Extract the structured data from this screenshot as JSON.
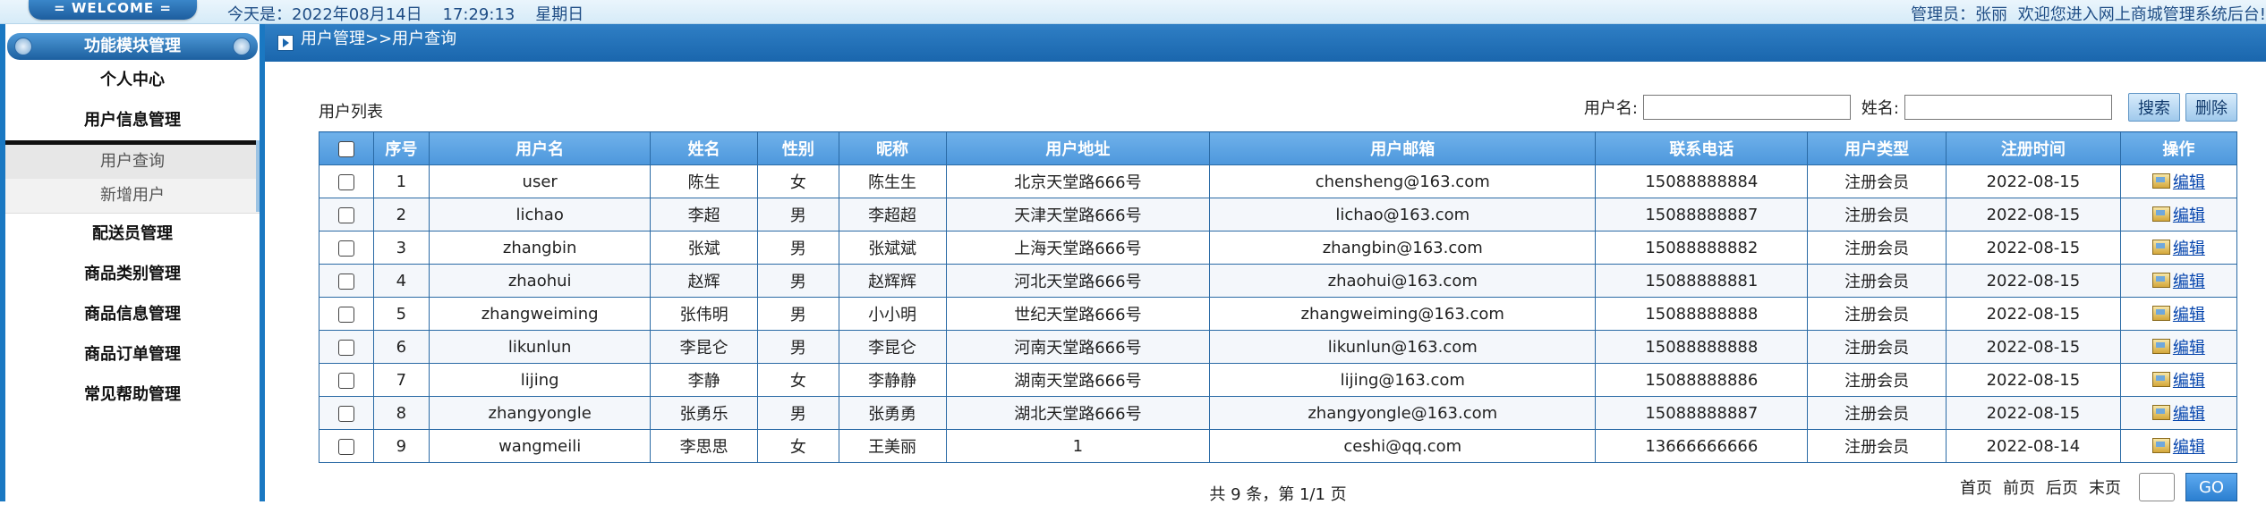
{
  "header": {
    "welcome": "= WELCOME =",
    "datetime": "今天是：2022年08月14日    17:29:13    星期日",
    "admin_label": "管理员：张丽",
    "greeting": "欢迎您进入网上商城管理系统后台!"
  },
  "sidebar": {
    "title": "功能模块管理",
    "items": [
      {
        "label": "个人中心"
      },
      {
        "label": "用户信息管理"
      },
      {
        "label": "配送员管理"
      },
      {
        "label": "商品类别管理"
      },
      {
        "label": "商品信息管理"
      },
      {
        "label": "商品订单管理"
      },
      {
        "label": "常见帮助管理"
      }
    ],
    "subitems": [
      {
        "label": "用户查询"
      },
      {
        "label": "新增用户"
      }
    ]
  },
  "breadcrumb": "用户管理>>用户查询",
  "list": {
    "title": "用户列表",
    "search_username_label": "用户名:",
    "search_username_value": "",
    "search_name_label": "姓名:",
    "search_name_value": "",
    "search_button": "搜索",
    "delete_button": "删除"
  },
  "table": {
    "columns": [
      "序号",
      "用户名",
      "姓名",
      "性别",
      "昵称",
      "用户地址",
      "用户邮箱",
      "联系电话",
      "用户类型",
      "注册时间",
      "操作"
    ],
    "rows": [
      [
        "1",
        "user",
        "陈生",
        "女",
        "陈生生",
        "北京天堂路666号",
        "chensheng@163.com",
        "15088888884",
        "注册会员",
        "2022-08-15"
      ],
      [
        "2",
        "lichao",
        "李超",
        "男",
        "李超超",
        "天津天堂路666号",
        "lichao@163.com",
        "15088888887",
        "注册会员",
        "2022-08-15"
      ],
      [
        "3",
        "zhangbin",
        "张斌",
        "男",
        "张斌斌",
        "上海天堂路666号",
        "zhangbin@163.com",
        "15088888882",
        "注册会员",
        "2022-08-15"
      ],
      [
        "4",
        "zhaohui",
        "赵辉",
        "男",
        "赵辉辉",
        "河北天堂路666号",
        "zhaohui@163.com",
        "15088888881",
        "注册会员",
        "2022-08-15"
      ],
      [
        "5",
        "zhangweiming",
        "张伟明",
        "男",
        "小小明",
        "世纪天堂路666号",
        "zhangweiming@163.com",
        "15088888888",
        "注册会员",
        "2022-08-15"
      ],
      [
        "6",
        "likunlun",
        "李昆仑",
        "男",
        "李昆仑",
        "河南天堂路666号",
        "likunlun@163.com",
        "15088888888",
        "注册会员",
        "2022-08-15"
      ],
      [
        "7",
        "lijing",
        "李静",
        "女",
        "李静静",
        "湖南天堂路666号",
        "lijing@163.com",
        "15088888886",
        "注册会员",
        "2022-08-15"
      ],
      [
        "8",
        "zhangyongle",
        "张勇乐",
        "男",
        "张勇勇",
        "湖北天堂路666号",
        "zhangyongle@163.com",
        "15088888887",
        "注册会员",
        "2022-08-15"
      ],
      [
        "9",
        "wangmeili",
        "李思思",
        "女",
        "王美丽",
        "1",
        "ceshi@qq.com",
        "13666666666",
        "注册会员",
        "2022-08-14"
      ]
    ],
    "edit_label": "编辑"
  },
  "pagination": {
    "summary": "共 9 条，第 1/1 页",
    "first": "首页",
    "prev": "前页",
    "next": "后页",
    "last": "末页",
    "go_label": "GO",
    "page_input_value": ""
  }
}
